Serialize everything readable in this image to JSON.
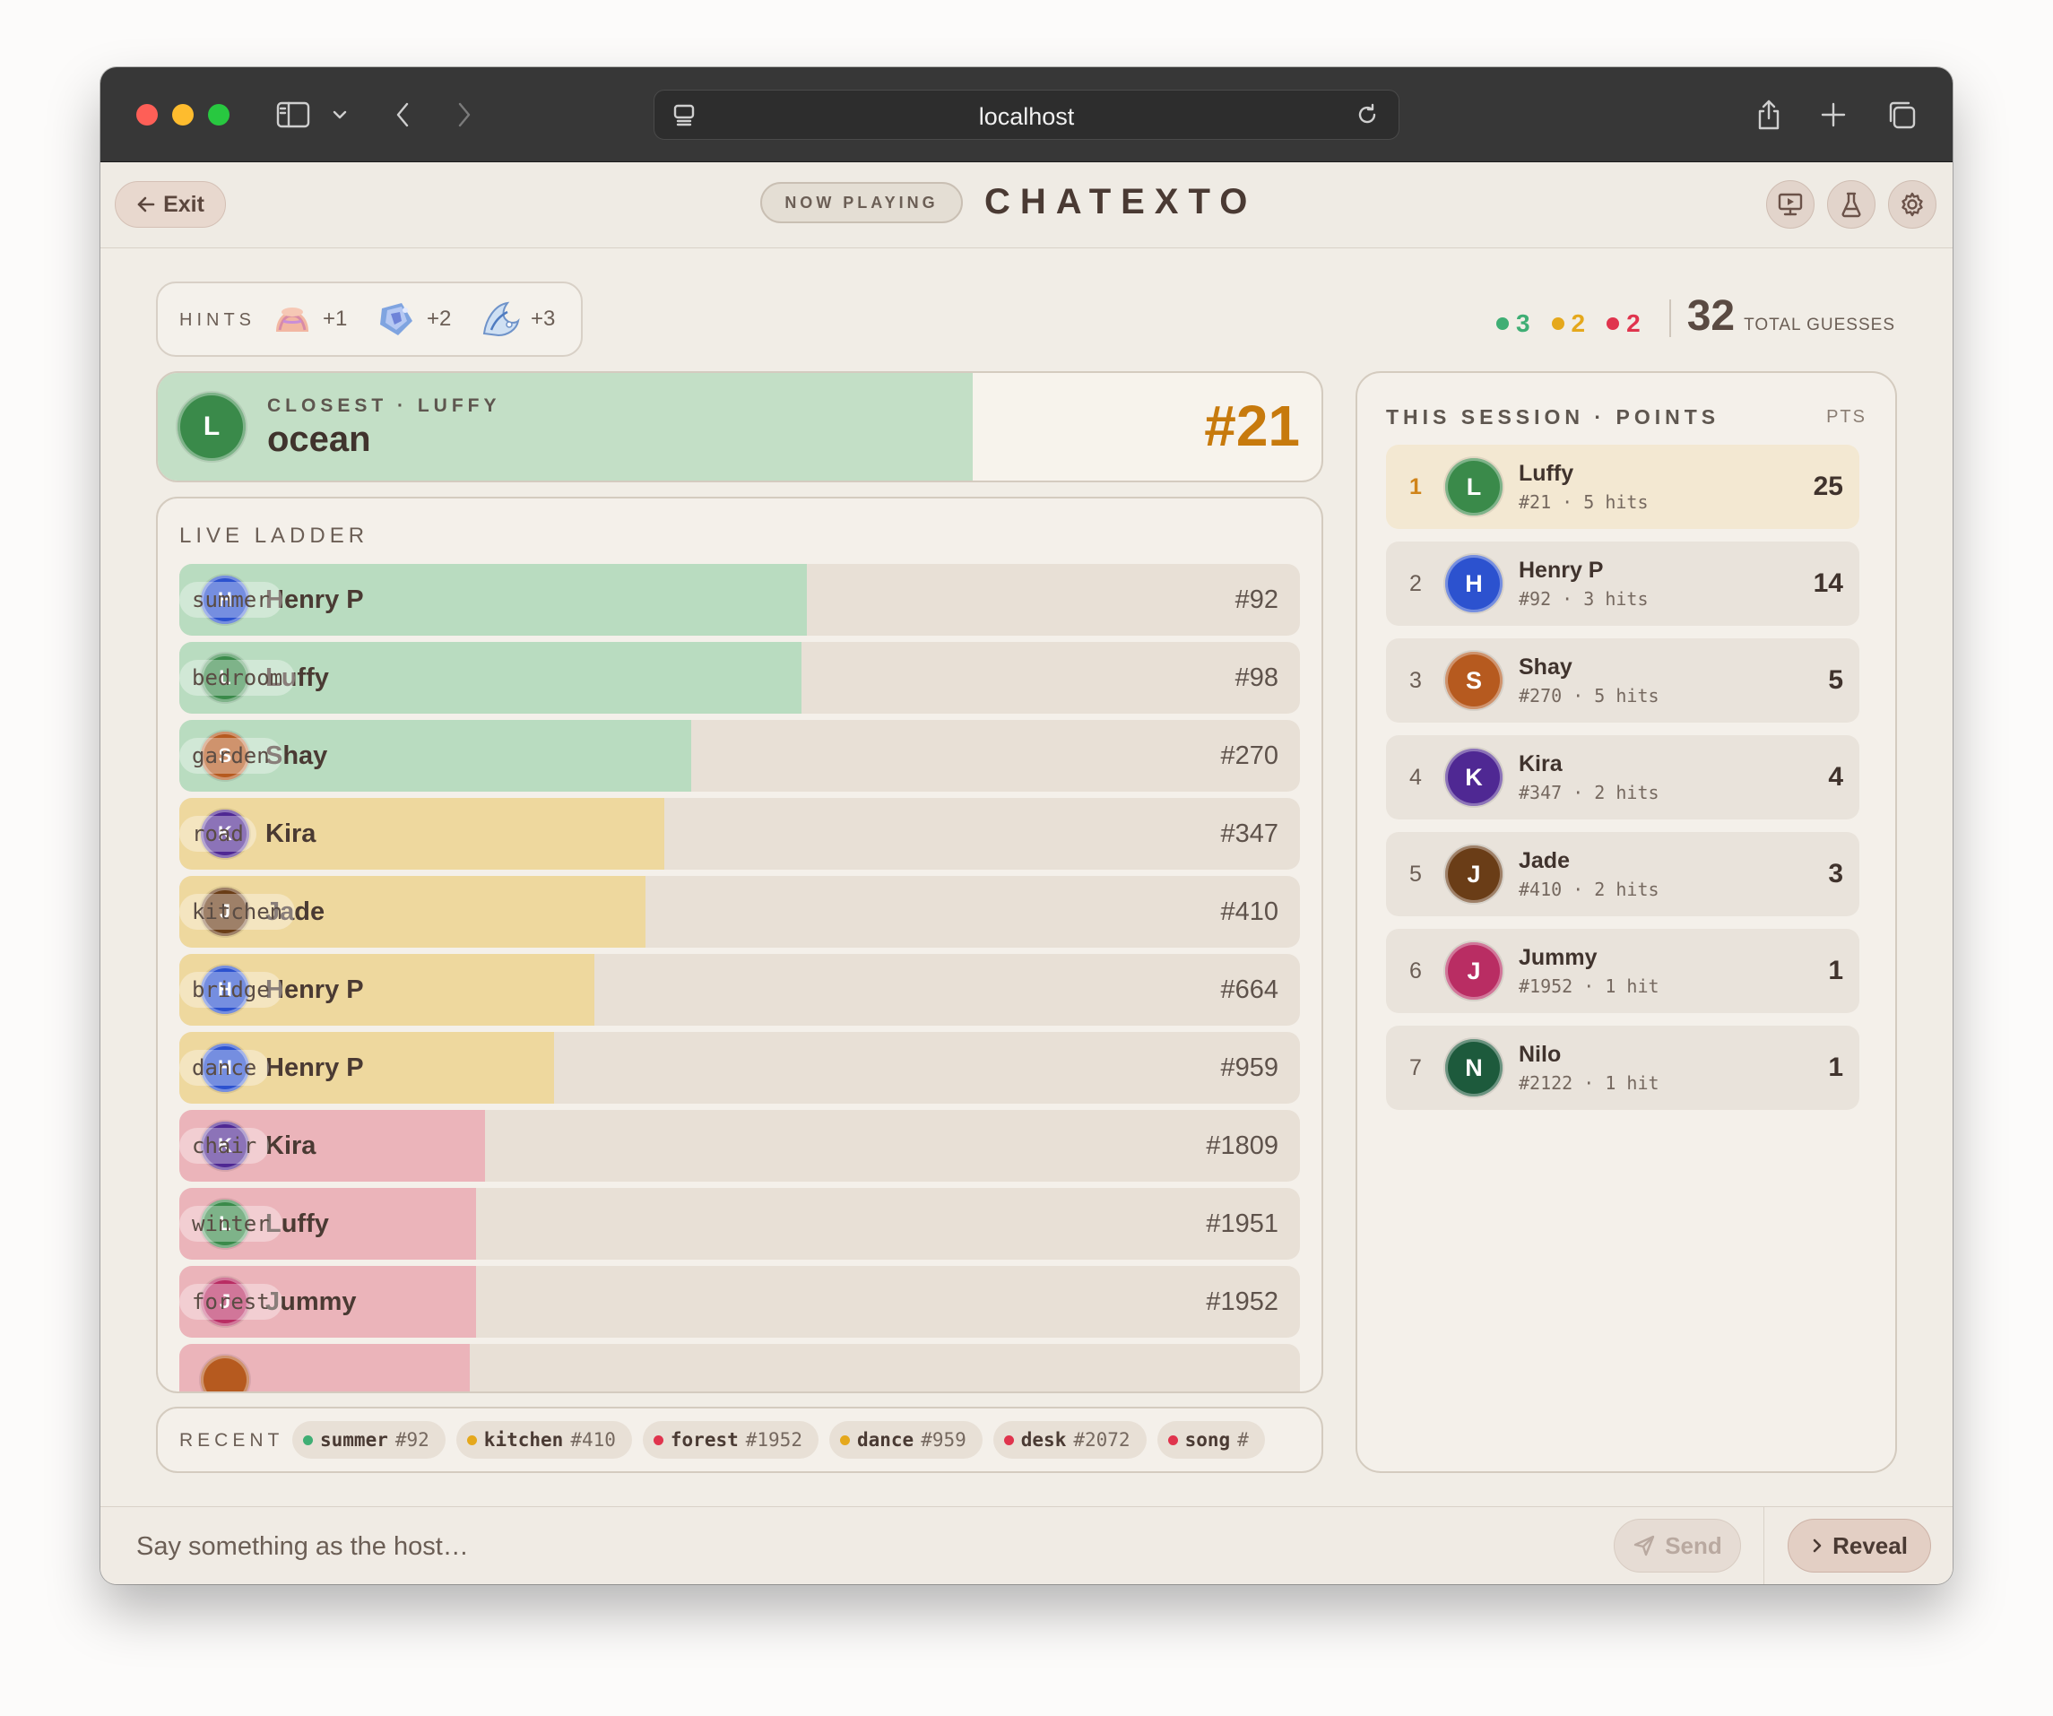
{
  "browser": {
    "url": "localhost"
  },
  "header": {
    "exit_label": "Exit",
    "badge": "NOW PLAYING",
    "title": "CHATEXTO"
  },
  "hints": {
    "label": "HINTS",
    "items": [
      {
        "value": "+1",
        "icon": "hat-hint-image"
      },
      {
        "value": "+2",
        "icon": "crystal-hint-image"
      },
      {
        "value": "+3",
        "icon": "wave-hint-image"
      }
    ]
  },
  "totals": {
    "green": "3",
    "yellow": "2",
    "red": "2",
    "total": "32",
    "total_label": "TOTAL GUESSES",
    "colors": {
      "green": "#3fae74",
      "yellow": "#e5a81c",
      "red": "#e0344d"
    }
  },
  "closest": {
    "label": "CLOSEST · LUFFY",
    "word": "ocean",
    "rank": "#21",
    "initial": "L",
    "progress": 0.7
  },
  "ladder": {
    "title": "LIVE LADDER",
    "rows": [
      {
        "initial": "H",
        "name": "Henry P",
        "word": "summer",
        "rank": "#92",
        "fill": 0.56,
        "band": "green"
      },
      {
        "initial": "L",
        "name": "Luffy",
        "word": "bedroom",
        "rank": "#98",
        "fill": 0.555,
        "band": "green"
      },
      {
        "initial": "S",
        "name": "Shay",
        "word": "garden",
        "rank": "#270",
        "fill": 0.457,
        "band": "green"
      },
      {
        "initial": "K",
        "name": "Kira",
        "word": "road",
        "rank": "#347",
        "fill": 0.433,
        "band": "yellow"
      },
      {
        "initial": "J",
        "name": "Jade",
        "word": "kitchen",
        "rank": "#410",
        "fill": 0.416,
        "band": "yellow"
      },
      {
        "initial": "H",
        "name": "Henry P",
        "word": "bridge",
        "rank": "#664",
        "fill": 0.37,
        "band": "yellow"
      },
      {
        "initial": "H",
        "name": "Henry P",
        "word": "dance",
        "rank": "#959",
        "fill": 0.334,
        "band": "yellow"
      },
      {
        "initial": "K",
        "name": "Kira",
        "word": "chair",
        "rank": "#1809",
        "fill": 0.273,
        "band": "red"
      },
      {
        "initial": "L",
        "name": "Luffy",
        "word": "winter",
        "rank": "#1951",
        "fill": 0.265,
        "band": "red"
      },
      {
        "initial": "J",
        "name": "Jummy",
        "word": "forest",
        "rank": "#1952",
        "fill": 0.265,
        "band": "red"
      },
      {
        "initial": "",
        "name": "",
        "word": "",
        "rank": "",
        "fill": 0.259,
        "band": "red"
      }
    ]
  },
  "recent": {
    "label": "RECENT",
    "chips": [
      {
        "word": "summer",
        "rank": "#92",
        "band": "green"
      },
      {
        "word": "kitchen",
        "rank": "#410",
        "band": "yellow"
      },
      {
        "word": "forest",
        "rank": "#1952",
        "band": "red"
      },
      {
        "word": "dance",
        "rank": "#959",
        "band": "yellow"
      },
      {
        "word": "desk",
        "rank": "#2072",
        "band": "red"
      },
      {
        "word": "song",
        "rank": "#",
        "band": "red"
      }
    ]
  },
  "session": {
    "title": "THIS SESSION · POINTS",
    "pts_label": "PTS",
    "rows": [
      {
        "pos": "1",
        "initial": "L",
        "name": "Luffy",
        "meta": "#21 · 5 hits",
        "score": "25"
      },
      {
        "pos": "2",
        "initial": "H",
        "name": "Henry P",
        "meta": "#92 · 3 hits",
        "score": "14"
      },
      {
        "pos": "3",
        "initial": "S",
        "name": "Shay",
        "meta": "#270 · 5 hits",
        "score": "5"
      },
      {
        "pos": "4",
        "initial": "K",
        "name": "Kira",
        "meta": "#347 · 2 hits",
        "score": "4"
      },
      {
        "pos": "5",
        "initial": "J",
        "name": "Jade",
        "meta": "#410 · 2 hits",
        "score": "3"
      },
      {
        "pos": "6",
        "initial": "J",
        "name": "Jummy",
        "meta": "#1952 · 1 hit",
        "score": "1"
      },
      {
        "pos": "7",
        "initial": "N",
        "name": "Nilo",
        "meta": "#2122 · 1 hit",
        "score": "1"
      }
    ]
  },
  "composer": {
    "placeholder": "Say something as the host…",
    "send_label": "Send",
    "reveal_label": "Reveal"
  },
  "player_colors": {
    "Luffy": "#3a8a4a",
    "Henry P": "#2c52cf",
    "Shay": "#b65a1f",
    "Kira": "#4f2893",
    "Jade": "#6a3d17",
    "Jummy": "#b92d63",
    "Nilo": "#1d5a3c"
  },
  "band_colors": {
    "green": "#b9dcc0",
    "yellow": "#eed89e",
    "red": "#ebb4ba"
  }
}
